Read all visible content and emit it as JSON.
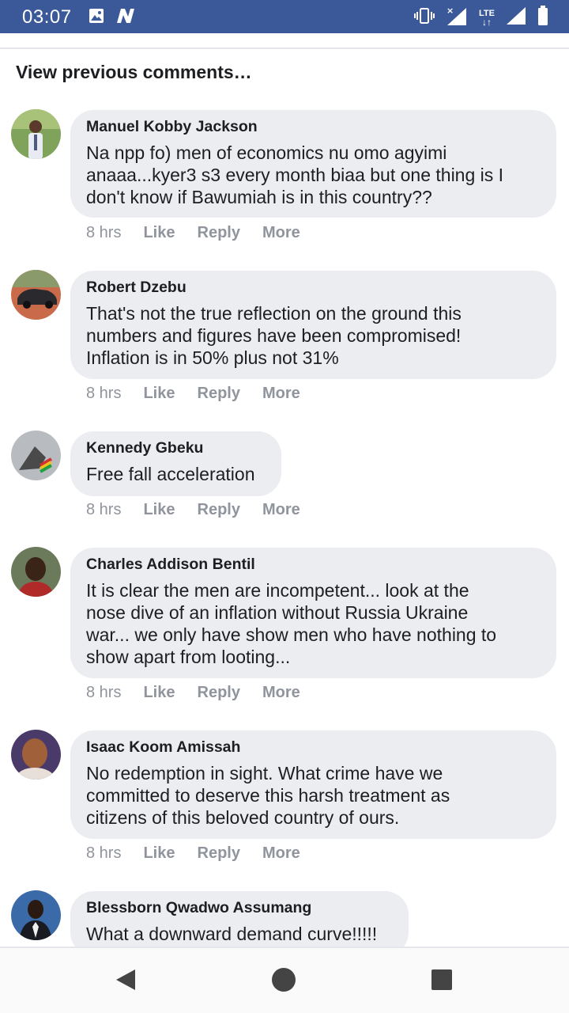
{
  "status_bar": {
    "time": "03:07",
    "network": "LTE",
    "icons": [
      "image-icon",
      "n-app-icon",
      "vibrate-icon",
      "signal-icon",
      "lte-icon",
      "signal-icon",
      "battery-icon"
    ],
    "bg_color": "#3b5998"
  },
  "view_previous": "View previous comments…",
  "comments": [
    {
      "author": "Manuel Kobby Jackson",
      "text": "Na npp fo) men of economics nu omo agyimi\nanaaa...kyer3 s3 every month biaa but one thing is I\ndon't know if Bawumiah is in this country??",
      "time": "8 hrs",
      "like": "Like",
      "reply": "Reply",
      "more": "More"
    },
    {
      "author": "Robert Dzebu",
      "text": "That's not the true reflection on the ground this\nnumbers and figures have been compromised!\nInflation is in 50% plus not 31%",
      "time": "8 hrs",
      "like": "Like",
      "reply": "Reply",
      "more": "More"
    },
    {
      "author": "Kennedy Gbeku",
      "text": "Free fall acceleration",
      "time": "8 hrs",
      "like": "Like",
      "reply": "Reply",
      "more": "More"
    },
    {
      "author": "Charles Addison Bentil",
      "text": "It is clear the men are incompetent... look at the\nnose dive of an inflation without Russia Ukraine\nwar... we only have show men who have nothing to\nshow apart from looting...",
      "time": "8 hrs",
      "like": "Like",
      "reply": "Reply",
      "more": "More"
    },
    {
      "author": "Isaac Koom Amissah",
      "text": "No redemption in sight. What crime have we\ncommitted to deserve this harsh treatment as\ncitizens of this beloved country of ours.",
      "time": "8 hrs",
      "like": "Like",
      "reply": "Reply",
      "more": "More"
    },
    {
      "author": "Blessborn Qwadwo Assumang",
      "text": "What a downward demand curve!!!!!"
    }
  ],
  "nav": {
    "back_icon": "back-triangle-icon",
    "home_icon": "home-circle-icon",
    "recents_icon": "recents-square-icon"
  },
  "colors": {
    "bubble": "#ebedf0",
    "meta_text": "#90949c",
    "text": "#1c1e21"
  }
}
